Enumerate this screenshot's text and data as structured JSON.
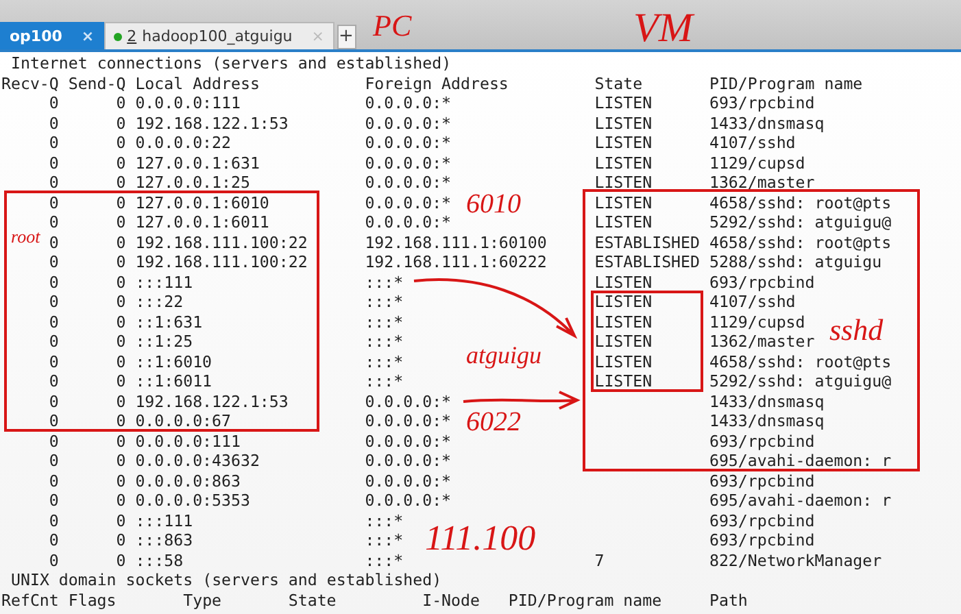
{
  "tabs": [
    {
      "label": "op100",
      "selected": true,
      "status_dot": false,
      "close": "×"
    },
    {
      "number": "2",
      "label": "hadoop100_atguigu",
      "selected": false,
      "status_dot": true,
      "close": "×"
    }
  ],
  "new_tab": "+",
  "internet": {
    "title": "Internet connections (servers and established)",
    "columns": [
      "Recv-Q",
      "Send-Q",
      "Local Address",
      "Foreign Address",
      "State",
      "PID/Program name"
    ],
    "rows": [
      {
        "recv_q": "0",
        "send_q": "0",
        "local_address": "0.0.0.0:111",
        "foreign_address": "0.0.0.0:*",
        "state": "LISTEN",
        "pid_program": "693/rpcbind"
      },
      {
        "recv_q": "0",
        "send_q": "0",
        "local_address": "192.168.122.1:53",
        "foreign_address": "0.0.0.0:*",
        "state": "LISTEN",
        "pid_program": "1433/dnsmasq"
      },
      {
        "recv_q": "0",
        "send_q": "0",
        "local_address": "0.0.0.0:22",
        "foreign_address": "0.0.0.0:*",
        "state": "LISTEN",
        "pid_program": "4107/sshd"
      },
      {
        "recv_q": "0",
        "send_q": "0",
        "local_address": "127.0.0.1:631",
        "foreign_address": "0.0.0.0:*",
        "state": "LISTEN",
        "pid_program": "1129/cupsd"
      },
      {
        "recv_q": "0",
        "send_q": "0",
        "local_address": "127.0.0.1:25",
        "foreign_address": "0.0.0.0:*",
        "state": "LISTEN",
        "pid_program": "1362/master"
      },
      {
        "recv_q": "0",
        "send_q": "0",
        "local_address": "127.0.0.1:6010",
        "foreign_address": "0.0.0.0:*",
        "state": "LISTEN",
        "pid_program": "4658/sshd: root@pts"
      },
      {
        "recv_q": "0",
        "send_q": "0",
        "local_address": "127.0.0.1:6011",
        "foreign_address": "0.0.0.0:*",
        "state": "LISTEN",
        "pid_program": "5292/sshd: atguigu@"
      },
      {
        "recv_q": "0",
        "send_q": "0",
        "local_address": "192.168.111.100:22",
        "foreign_address": "192.168.111.1:60100",
        "state": "ESTABLISHED",
        "pid_program": "4658/sshd: root@pts"
      },
      {
        "recv_q": "0",
        "send_q": "0",
        "local_address": "192.168.111.100:22",
        "foreign_address": "192.168.111.1:60222",
        "state": "ESTABLISHED",
        "pid_program": "5288/sshd: atguigu"
      },
      {
        "recv_q": "0",
        "send_q": "0",
        "local_address": ":::111",
        "foreign_address": ":::*",
        "state": "LISTEN",
        "pid_program": "693/rpcbind"
      },
      {
        "recv_q": "0",
        "send_q": "0",
        "local_address": ":::22",
        "foreign_address": ":::*",
        "state": "LISTEN",
        "pid_program": "4107/sshd"
      },
      {
        "recv_q": "0",
        "send_q": "0",
        "local_address": "::1:631",
        "foreign_address": ":::*",
        "state": "LISTEN",
        "pid_program": "1129/cupsd"
      },
      {
        "recv_q": "0",
        "send_q": "0",
        "local_address": "::1:25",
        "foreign_address": ":::*",
        "state": "LISTEN",
        "pid_program": "1362/master"
      },
      {
        "recv_q": "0",
        "send_q": "0",
        "local_address": "::1:6010",
        "foreign_address": ":::*",
        "state": "LISTEN",
        "pid_program": "4658/sshd: root@pts"
      },
      {
        "recv_q": "0",
        "send_q": "0",
        "local_address": "::1:6011",
        "foreign_address": ":::*",
        "state": "LISTEN",
        "pid_program": "5292/sshd: atguigu@"
      },
      {
        "recv_q": "0",
        "send_q": "0",
        "local_address": "192.168.122.1:53",
        "foreign_address": "0.0.0.0:*",
        "pid_program": "1433/dnsmasq"
      },
      {
        "recv_q": "0",
        "send_q": "0",
        "local_address": "0.0.0.0:67",
        "foreign_address": "0.0.0.0:*",
        "pid_program": "1433/dnsmasq"
      },
      {
        "recv_q": "0",
        "send_q": "0",
        "local_address": "0.0.0.0:111",
        "foreign_address": "0.0.0.0:*",
        "pid_program": "693/rpcbind"
      },
      {
        "recv_q": "0",
        "send_q": "0",
        "local_address": "0.0.0.0:43632",
        "foreign_address": "0.0.0.0:*",
        "pid_program": "695/avahi-daemon: r"
      },
      {
        "recv_q": "0",
        "send_q": "0",
        "local_address": "0.0.0.0:863",
        "foreign_address": "0.0.0.0:*",
        "pid_program": "693/rpcbind"
      },
      {
        "recv_q": "0",
        "send_q": "0",
        "local_address": "0.0.0.0:5353",
        "foreign_address": "0.0.0.0:*",
        "pid_program": "695/avahi-daemon: r"
      },
      {
        "recv_q": "0",
        "send_q": "0",
        "local_address": ":::111",
        "foreign_address": ":::*",
        "pid_program": "693/rpcbind"
      },
      {
        "recv_q": "0",
        "send_q": "0",
        "local_address": ":::863",
        "foreign_address": ":::*",
        "pid_program": "693/rpcbind"
      },
      {
        "recv_q": "0",
        "send_q": "0",
        "local_address": ":::58",
        "foreign_address": ":::*",
        "state": "7",
        "pid_program": "822/NetworkManager"
      }
    ]
  },
  "unix": {
    "title": "UNIX domain sockets (servers and established)",
    "columns": [
      "RefCnt",
      "Flags",
      "Type",
      "State",
      "I-Node",
      "PID/Program name",
      "Path"
    ]
  },
  "handwritten_notes": [
    {
      "text": "PC"
    },
    {
      "text": "VM"
    },
    {
      "text": "6010"
    },
    {
      "text": "root"
    },
    {
      "text": "atguigu"
    },
    {
      "text": "sshd"
    },
    {
      "text": "6022"
    },
    {
      "text": "111.100"
    }
  ]
}
